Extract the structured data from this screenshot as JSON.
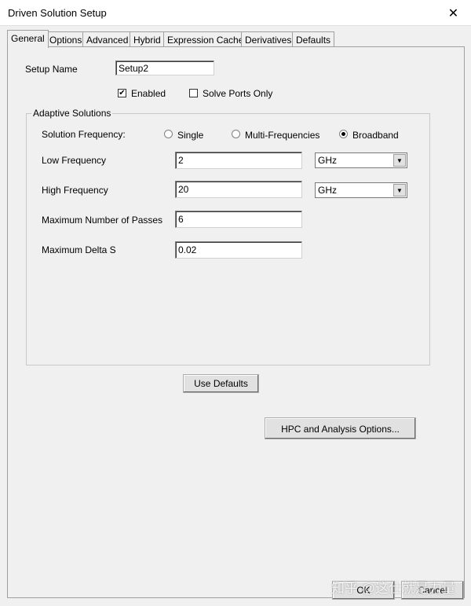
{
  "window": {
    "title": "Driven Solution Setup",
    "close_glyph": "✕"
  },
  "tabs": [
    "General",
    "Options",
    "Advanced",
    "Hybrid",
    "Expression Cache",
    "Derivatives",
    "Defaults"
  ],
  "general": {
    "setup_name_label": "Setup Name",
    "setup_name_value": "Setup2",
    "enabled_label": "Enabled",
    "enabled_checked": true,
    "solve_ports_only_label": "Solve Ports Only",
    "solve_ports_only_checked": false
  },
  "adaptive": {
    "group_title": "Adaptive Solutions",
    "solution_frequency_label": "Solution Frequency:",
    "options": [
      "Single",
      "Multi-Frequencies",
      "Broadband"
    ],
    "selected": "Broadband",
    "low_frequency_label": "Low Frequency",
    "low_frequency_value": "2",
    "low_frequency_unit": "GHz",
    "high_frequency_label": "High Frequency",
    "high_frequency_value": "20",
    "high_frequency_unit": "GHz",
    "max_passes_label": "Maximum Number of Passes",
    "max_passes_value": "6",
    "max_delta_label": "Maximum Delta S",
    "max_delta_value": "0.02"
  },
  "buttons": {
    "use_defaults": "Use Defaults",
    "hpc_options": "HPC and Analysis Options...",
    "ok": "OK",
    "cancel": "Cancel"
  },
  "watermark": "知乎 @这仕就是力量",
  "icons": {
    "dropdown_arrow": "▼",
    "check": "✔"
  }
}
